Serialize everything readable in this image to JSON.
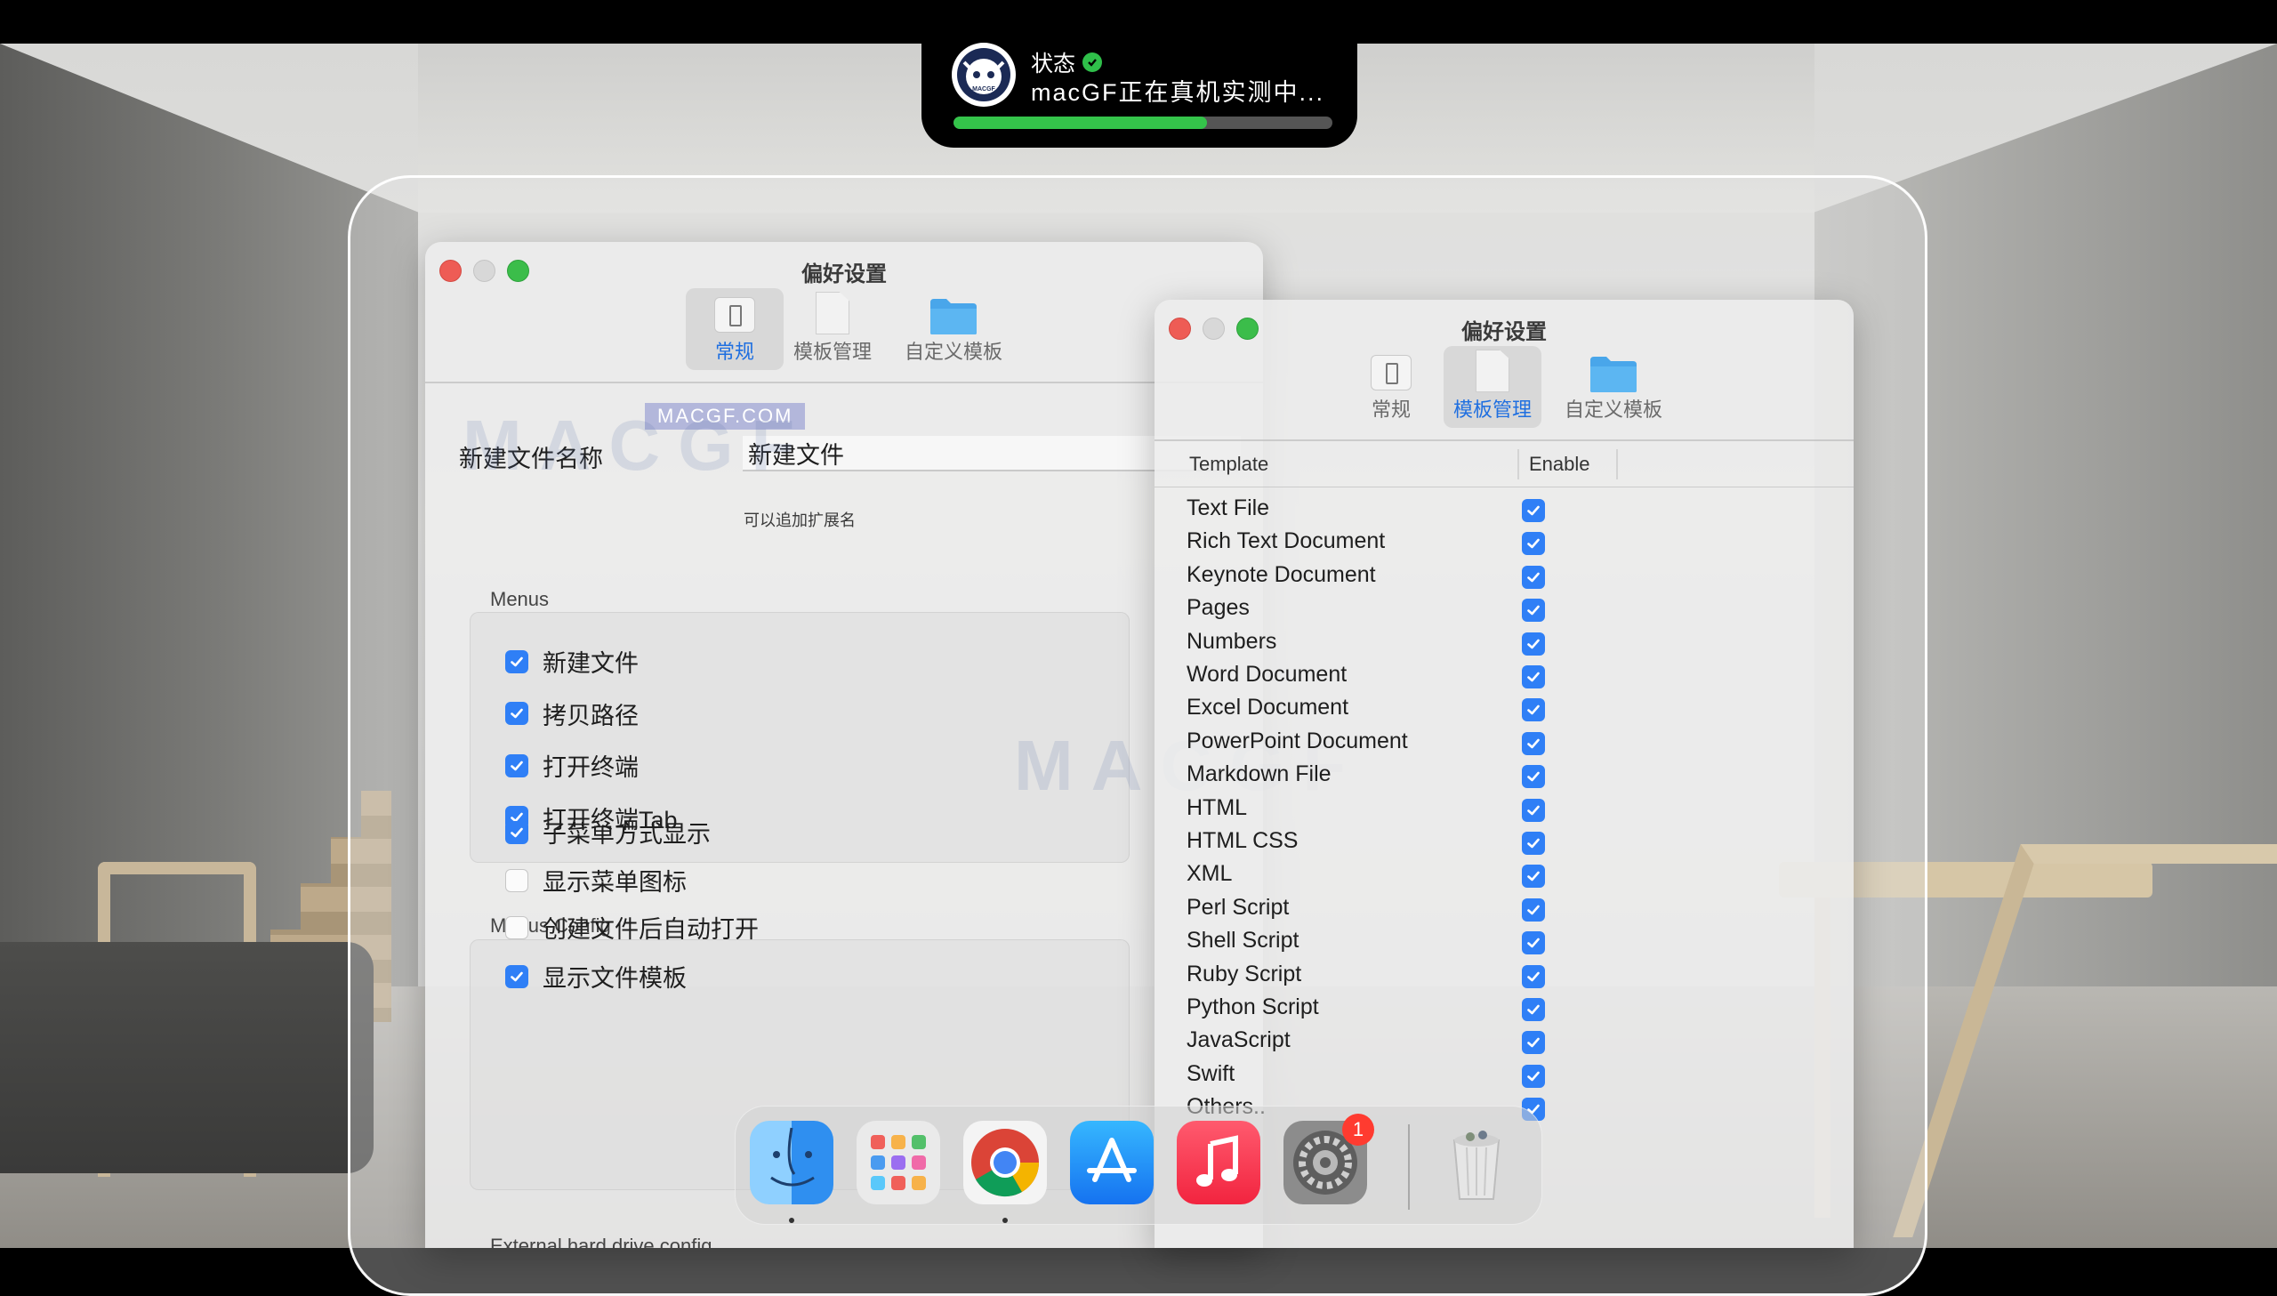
{
  "status_island": {
    "title": "状态",
    "message": "macGF正在真机实测中...",
    "progress_percent": 67,
    "avatar_text": "MACGF"
  },
  "watermark": {
    "badge": "MACGF.COM",
    "logo_text": "MACGF"
  },
  "left_window": {
    "title": "偏好设置",
    "toolbar": [
      {
        "label": "常规",
        "icon": "switch-icon",
        "selected": true
      },
      {
        "label": "模板管理",
        "icon": "document-icon",
        "selected": false
      },
      {
        "label": "自定义模板",
        "icon": "folder-icon",
        "selected": false
      }
    ],
    "new_file_name_label": "新建文件名称",
    "new_file_name_value": "新建文件",
    "extension_hint": "可以追加扩展名",
    "menus_title": "Menus",
    "menus": [
      {
        "label": "新建文件",
        "checked": true
      },
      {
        "label": "拷贝路径",
        "checked": true
      },
      {
        "label": "打开终端",
        "checked": true
      },
      {
        "label": "打开终端Tab",
        "checked": true
      }
    ],
    "menus_config_title": "Menus Config",
    "menus_config": [
      {
        "label": "子菜单方式显示",
        "checked": true
      },
      {
        "label": "显示菜单图标",
        "checked": false
      },
      {
        "label": "创建文件后自动打开",
        "checked": false
      },
      {
        "label": "显示文件模板",
        "checked": true
      }
    ],
    "external_title": "External hard drive config"
  },
  "right_window": {
    "title": "偏好设置",
    "toolbar": [
      {
        "label": "常规",
        "icon": "switch-icon",
        "selected": false
      },
      {
        "label": "模板管理",
        "icon": "document-icon",
        "selected": true
      },
      {
        "label": "自定义模板",
        "icon": "folder-icon",
        "selected": false
      }
    ],
    "columns": {
      "template": "Template",
      "enable": "Enable"
    },
    "templates": [
      {
        "name": "Text File",
        "enabled": true
      },
      {
        "name": "Rich Text Document",
        "enabled": true
      },
      {
        "name": "Keynote Document",
        "enabled": true
      },
      {
        "name": "Pages",
        "enabled": true
      },
      {
        "name": "Numbers",
        "enabled": true
      },
      {
        "name": "Word Document",
        "enabled": true
      },
      {
        "name": "Excel Document",
        "enabled": true
      },
      {
        "name": "PowerPoint Document",
        "enabled": true
      },
      {
        "name": "Markdown File",
        "enabled": true
      },
      {
        "name": "HTML",
        "enabled": true
      },
      {
        "name": "HTML CSS",
        "enabled": true
      },
      {
        "name": "XML",
        "enabled": true
      },
      {
        "name": "Perl Script",
        "enabled": true
      },
      {
        "name": "Shell Script",
        "enabled": true
      },
      {
        "name": "Ruby Script",
        "enabled": true
      },
      {
        "name": "Python Script",
        "enabled": true
      },
      {
        "name": "JavaScript",
        "enabled": true
      },
      {
        "name": "Swift",
        "enabled": true
      },
      {
        "name": "Others..",
        "enabled": true
      }
    ]
  },
  "dock": {
    "apps": [
      {
        "name": "finder",
        "running": true
      },
      {
        "name": "launchpad",
        "running": false
      },
      {
        "name": "chrome",
        "running": true
      },
      {
        "name": "app-store",
        "running": false
      },
      {
        "name": "music",
        "running": false
      },
      {
        "name": "system-preferences",
        "running": false,
        "badge": "1"
      },
      {
        "name": "trash",
        "running": false
      }
    ]
  },
  "colors": {
    "accent": "#2f7ff6",
    "selected_tab_text": "#1f6fe0",
    "progress": "#34c44a",
    "close": "#ee5c55",
    "zoom": "#3bbd4a",
    "badge": "#ff3b30"
  }
}
